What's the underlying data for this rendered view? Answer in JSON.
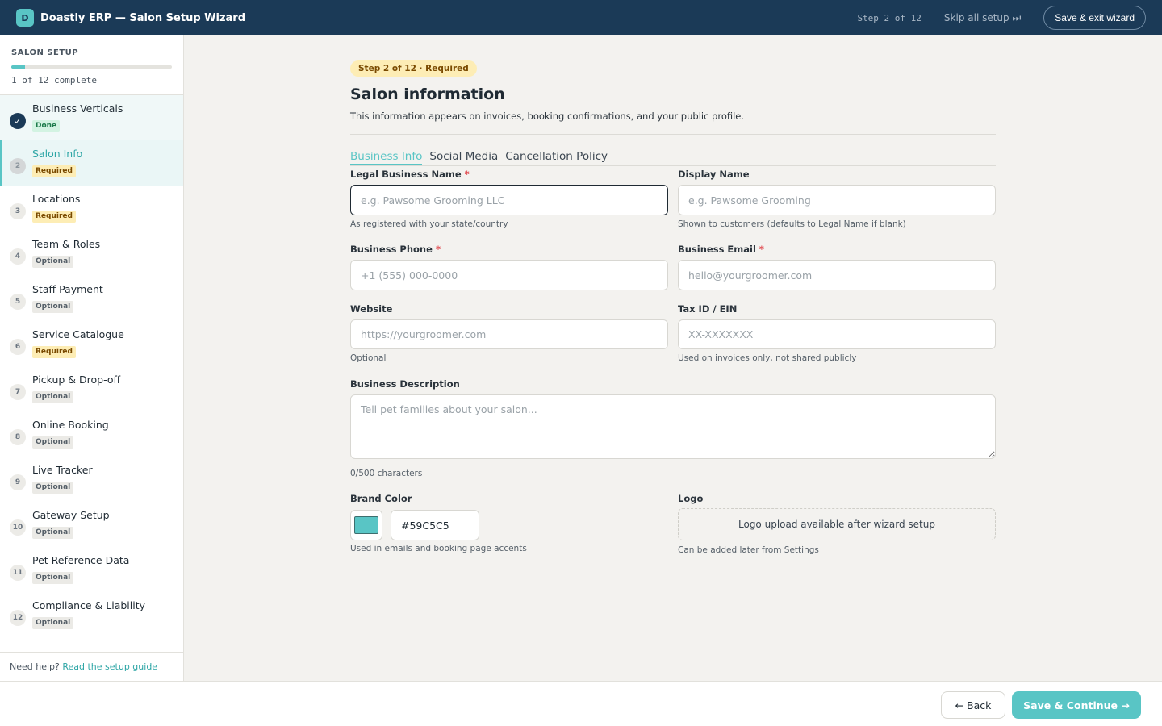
{
  "app": {
    "logo_letter": "D",
    "title": "Doastly ERP — Salon Setup Wizard",
    "step_counter": "Step 2 of 12",
    "skip_label": "Skip all setup ⏭",
    "exit_label": "Save & exit wizard"
  },
  "sidebar": {
    "title": "SALON SETUP",
    "progress_fraction": 0.083,
    "progress_text": "1 of 12 complete",
    "steps": [
      {
        "num": "✓",
        "label": "Business Verticals",
        "badge": "Done",
        "status": "done"
      },
      {
        "num": "2",
        "label": "Salon Info",
        "badge": "Required",
        "status": "active"
      },
      {
        "num": "3",
        "label": "Locations",
        "badge": "Required",
        "status": "required"
      },
      {
        "num": "4",
        "label": "Team & Roles",
        "badge": "Optional",
        "status": "optional"
      },
      {
        "num": "5",
        "label": "Staff Payment",
        "badge": "Optional",
        "status": "optional"
      },
      {
        "num": "6",
        "label": "Service Catalogue",
        "badge": "Required",
        "status": "required"
      },
      {
        "num": "7",
        "label": "Pickup & Drop-off",
        "badge": "Optional",
        "status": "optional"
      },
      {
        "num": "8",
        "label": "Online Booking",
        "badge": "Optional",
        "status": "optional"
      },
      {
        "num": "9",
        "label": "Live Tracker",
        "badge": "Optional",
        "status": "optional"
      },
      {
        "num": "10",
        "label": "Gateway Setup",
        "badge": "Optional",
        "status": "optional"
      },
      {
        "num": "11",
        "label": "Pet Reference Data",
        "badge": "Optional",
        "status": "optional"
      },
      {
        "num": "12",
        "label": "Compliance & Liability",
        "badge": "Optional",
        "status": "optional"
      }
    ],
    "help_prefix": "Need help?",
    "help_link": "Read the setup guide"
  },
  "main": {
    "step_pill": "Step 2 of 12 · Required",
    "title": "Salon information",
    "subtitle": "This information appears on invoices, booking confirmations, and your public profile.",
    "tabs": [
      "Business Info",
      "Social Media",
      "Cancellation Policy"
    ],
    "fields": {
      "legal_name": {
        "label": "Legal Business Name",
        "placeholder": "e.g. Pawsome Grooming LLC",
        "help": "As registered with your state/country"
      },
      "display_name": {
        "label": "Display Name",
        "placeholder": "e.g. Pawsome Grooming",
        "help": "Shown to customers (defaults to Legal Name if blank)"
      },
      "phone": {
        "label": "Business Phone",
        "placeholder": "+1 (555) 000-0000"
      },
      "email": {
        "label": "Business Email",
        "placeholder": "hello@yourgroomer.com"
      },
      "website": {
        "label": "Website",
        "placeholder": "https://yourgroomer.com",
        "help": "Optional"
      },
      "tax_id": {
        "label": "Tax ID / EIN",
        "placeholder": "XX-XXXXXXX",
        "help": "Used on invoices only, not shared publicly"
      },
      "description": {
        "label": "Business Description",
        "placeholder": "Tell pet families about your salon...",
        "counter": "0/500 characters"
      },
      "brand_color": {
        "label": "Brand Color",
        "value": "#59C5C5",
        "help": "Used in emails and booking page accents"
      },
      "logo": {
        "label": "Logo",
        "text": "Logo upload available after wizard setup",
        "help": "Can be added later from Settings"
      }
    },
    "required_mark": "*"
  },
  "footer": {
    "back_label": "← Back",
    "continue_label": "Save & Continue →"
  },
  "colors": {
    "accent": "#59C5C5",
    "topbar": "#1B3A57",
    "required": "#E0464B"
  }
}
